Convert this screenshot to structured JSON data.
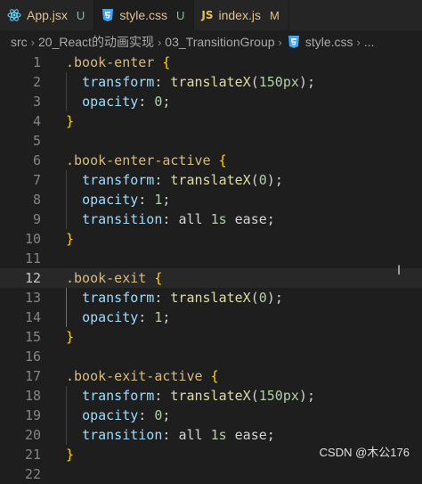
{
  "tabs": [
    {
      "name": "App.jsx",
      "badge": "U",
      "icon": "react-icon"
    },
    {
      "name": "style.css",
      "badge": "U",
      "icon": "css-icon"
    },
    {
      "name": "index.js",
      "badge": "M",
      "icon": "js-icon"
    }
  ],
  "breadcrumb": [
    "src",
    "20_React的动画实现",
    "03_TransitionGroup",
    "style.css",
    "..."
  ],
  "editor": {
    "current_line": 12,
    "line_numbers": [
      "1",
      "2",
      "3",
      "4",
      "5",
      "6",
      "7",
      "8",
      "9",
      "10",
      "11",
      "12",
      "13",
      "14",
      "15",
      "16",
      "17",
      "18",
      "19",
      "20",
      "21",
      "22"
    ],
    "lines": [
      ".book-enter {",
      "  transform: translateX(150px);",
      "  opacity: 0;",
      "}",
      "",
      ".book-enter-active {",
      "  transform: translateX(0);",
      "  opacity: 1;",
      "  transition: all 1s ease;",
      "}",
      "",
      ".book-exit {",
      "  transform: translateX(0);",
      "  opacity: 1;",
      "}",
      "",
      ".book-exit-active {",
      "  transform: translateX(150px);",
      "  opacity: 0;",
      "  transition: all 1s ease;",
      "}",
      ""
    ]
  },
  "watermark": "CSDN @木公176",
  "colors": {
    "editor_bg": "#1e1e1e",
    "tab_bg": "#252526",
    "selector": "#d7ba7d",
    "property": "#9cdcfe",
    "number": "#b5cea8",
    "function": "#dcdcaa",
    "brace": "#ffd700"
  }
}
